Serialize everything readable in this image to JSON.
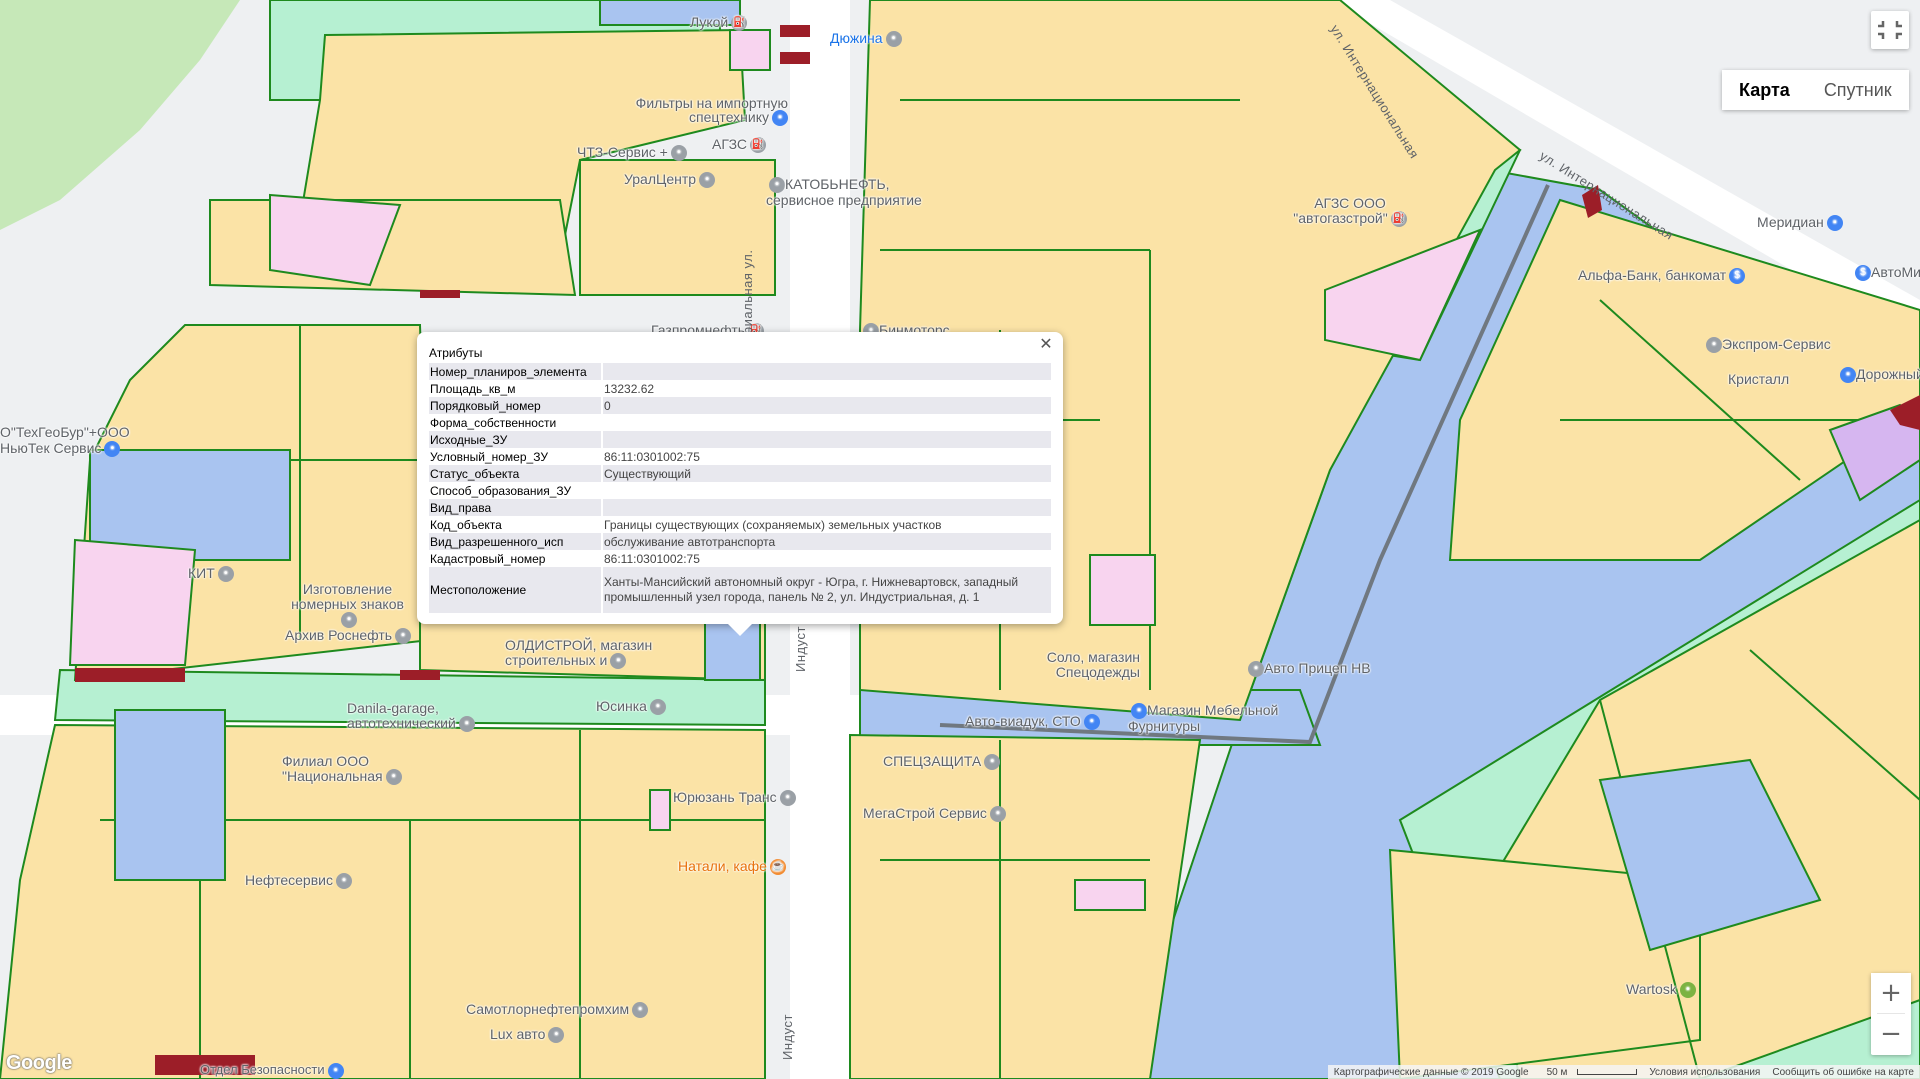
{
  "popup": {
    "title": "Атрибуты",
    "close_icon": "close-icon",
    "rows": [
      {
        "key": "Номер_планиров_элемента",
        "value": ""
      },
      {
        "key": "Площадь_кв_м",
        "value": "13232.62"
      },
      {
        "key": "Порядковый_номер",
        "value": "0"
      },
      {
        "key": "Форма_собственности",
        "value": ""
      },
      {
        "key": "Исходные_ЗУ",
        "value": ""
      },
      {
        "key": "Условный_номер_ЗУ",
        "value": "86:11:0301002:75"
      },
      {
        "key": "Статус_объекта",
        "value": "Существующий"
      },
      {
        "key": "Способ_образования_ЗУ",
        "value": ""
      },
      {
        "key": "Вид_права",
        "value": ""
      },
      {
        "key": "Код_объекта",
        "value": "Границы существующих (сохраняемых) земельных участков"
      },
      {
        "key": "Вид_разрешенного_исп",
        "value": "обслуживание автотранспорта"
      },
      {
        "key": "Кадастровый_номер",
        "value": "86:11:0301002:75"
      },
      {
        "key": "Местоположение",
        "value": "Ханты-Мансийский автономный округ - Югра, г. Нижневартовск, западный промышленный узел города, панель № 2, ул. Индустриальная, д. 1"
      }
    ]
  },
  "map_controls": {
    "fullscreen_icon": "fullscreen-icon",
    "map_type_options": [
      "Карта",
      "Спутник"
    ],
    "map_type_selected": "Карта",
    "zoom_in": "+",
    "zoom_out": "−"
  },
  "footer": {
    "attribution": "Картографические данные © 2019 Google",
    "scale": "50 м",
    "terms": "Условия использования",
    "report": "Сообщить об ошибке на карте"
  },
  "logo": "Google",
  "colors": {
    "parcel_fill": "#fbe3a6",
    "parcel_border": "#1e8a1e",
    "public_fill": "#b6f0d2",
    "blue_fill": "#a9c4f0",
    "pink_fill": "#f8d4ef",
    "violet_fill": "#d6b6f0",
    "dark_red": "#9c1e28"
  },
  "labels": {
    "poi": [
      {
        "text": "Лукой",
        "icon": "gas-station-icon"
      },
      {
        "text": "Дюжина",
        "icon": "pin-icon"
      },
      {
        "text": "Фильтры на импортную спецтехнику",
        "icon": "shop-icon"
      },
      {
        "text": "ЧТЗ-Сервис +",
        "icon": "pin-icon"
      },
      {
        "text": "АГЗС",
        "icon": "gas-station-icon"
      },
      {
        "text": "УралЦентр",
        "icon": "pin-icon"
      },
      {
        "text": "КАТОБЬНЕФТЬ, сервисное предприятие",
        "icon": "pin-icon"
      },
      {
        "text": "АГЗС ООО \"автогазстрой\"",
        "icon": "gas-station-icon"
      },
      {
        "text": "Меридиан",
        "icon": "shop-icon"
      },
      {
        "text": "Альфа-Банк, банкомат",
        "icon": "atm-icon"
      },
      {
        "text": "АвтоМир",
        "icon": "atm-icon"
      },
      {
        "text": "Газпромнефть",
        "icon": "gas-station-icon"
      },
      {
        "text": "Бинмоторс",
        "icon": "pin-icon"
      },
      {
        "text": "Экспром-Сервис",
        "icon": "pin-icon"
      },
      {
        "text": "Дорожный",
        "icon": "shop-icon"
      },
      {
        "text": "Кристалл",
        "icon": "pin-icon"
      },
      {
        "text": "О\"ТехГеоБур\"+ООО НьюТек Сервис",
        "icon": "pin-icon"
      },
      {
        "text": "КИТ",
        "icon": "pin-icon"
      },
      {
        "text": "Изготовление номерных знаков",
        "icon": "pin-icon"
      },
      {
        "text": "Архив Роснефть",
        "icon": "pin-icon"
      },
      {
        "text": "ОЛДИСТРОЙ, магазин строительных и",
        "icon": "shop-icon"
      },
      {
        "text": "Danila-garage, автотехнический",
        "icon": "shop-icon"
      },
      {
        "text": "Юсинка",
        "icon": "pin-icon"
      },
      {
        "text": "Филиал ООО \"Национальная",
        "icon": "pin-icon"
      },
      {
        "text": "Юрюзань Транс",
        "icon": "pin-icon"
      },
      {
        "text": "Нефтесервис",
        "icon": "pin-icon"
      },
      {
        "text": "Натали, кафе",
        "icon": "cafe-icon"
      },
      {
        "text": "Самотлорнефтепромхим",
        "icon": "pin-icon"
      },
      {
        "text": "Lux авто",
        "icon": "pin-icon"
      },
      {
        "text": "Авто-виадук, СТО",
        "icon": "pin-icon"
      },
      {
        "text": "Магазин Мебельной Фурнитуры",
        "icon": "shop-icon"
      },
      {
        "text": "Авто Прицеп НВ",
        "icon": "pin-icon"
      },
      {
        "text": "Соло, магазин Спецодежды",
        "icon": "shop-icon"
      },
      {
        "text": "СПЕЦЗАЩИТА",
        "icon": "pin-icon"
      },
      {
        "text": "МегаСтрой Сервис",
        "icon": "pin-icon"
      },
      {
        "text": "Wartosk",
        "icon": "pin-icon"
      },
      {
        "text": "Отдел Безопасности",
        "icon": "pin-icon"
      }
    ],
    "streets": [
      "Индустриальная ул.",
      "Индуст",
      "Индуст",
      "ул. Интернациональная",
      "ул. Интернациональная"
    ]
  }
}
